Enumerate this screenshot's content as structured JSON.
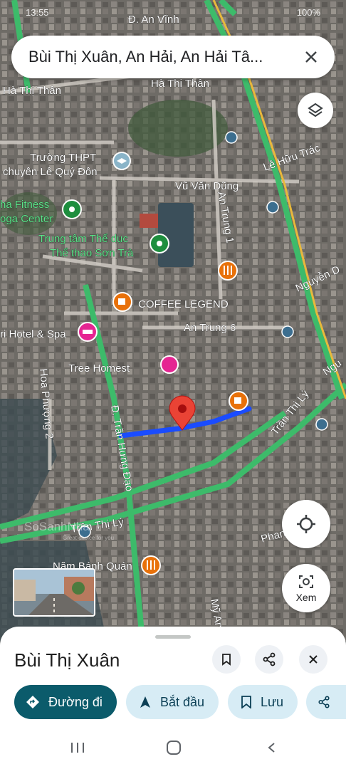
{
  "status": {
    "time": "13:55",
    "battery": "100%"
  },
  "search": {
    "query": "Bùi Thị Xuân, An Hải, An Hải Tâ..."
  },
  "map": {
    "streets": [
      "Đ. An Vĩnh",
      "Hà Thị Thân",
      "Hà Thị Thân",
      "Vũ Văn Dũng",
      "Lê Hữu Trác",
      "An Trung 1",
      "Nguyễn D",
      "An Trung 6",
      "Trần Thị Lý",
      "Trần Thị Lý",
      "Đ. Trần Hưng Đạo",
      "Hoa Phượng 2",
      "Phan",
      "Mỹ An",
      "Ngu"
    ],
    "pois": [
      {
        "name": "Trường THPT chuyên Lê Quý Đôn",
        "line1": "Trường THPT",
        "line2": "chuyên Lê Quý Đôn",
        "icon": "school-icon",
        "color": "#8ab4c8"
      },
      {
        "name": "ha Fitness oga Center",
        "line1": "ha Fitness",
        "line2": "oga Center",
        "icon": "fitness-icon",
        "color": "#1e8e3e"
      },
      {
        "name": "Trung tâm Thể dục Thể thao Sơn Trà",
        "line1": "Trung tâm Thể dục",
        "line2": "Thể thao Sơn Trà",
        "icon": "sport-icon",
        "color": "#1e8e3e"
      },
      {
        "name": "COFFEE LEGEND",
        "icon": "coffee-icon",
        "color": "#e8710a"
      },
      {
        "name": "ri Hotel & Spa",
        "icon": "hotel-icon",
        "color": "#e52592"
      },
      {
        "name": "Tree Homest",
        "icon": "home-icon",
        "color": "#e52592"
      },
      {
        "name": "Năm Bánh Quán",
        "icon": "restaurant-icon",
        "color": "#e8710a"
      }
    ],
    "watermark": {
      "brand": "SoSanhNha",
      "tagline": "Great choice for you"
    }
  },
  "buttons": {
    "lens_label": "Xem"
  },
  "sheet": {
    "title": "Bùi Thị Xuân",
    "chips": [
      {
        "label": "Đường đi",
        "icon": "directions-icon"
      },
      {
        "label": "Bắt đầu",
        "icon": "navigation-icon"
      },
      {
        "label": "Lưu",
        "icon": "bookmark-icon"
      }
    ]
  },
  "colors": {
    "primary_chip": "#0b5b6b",
    "secondary_chip": "#d7ecf5",
    "route": "#1a4cff",
    "pin": "#ea4335",
    "road_green": "#3dbb6a"
  }
}
